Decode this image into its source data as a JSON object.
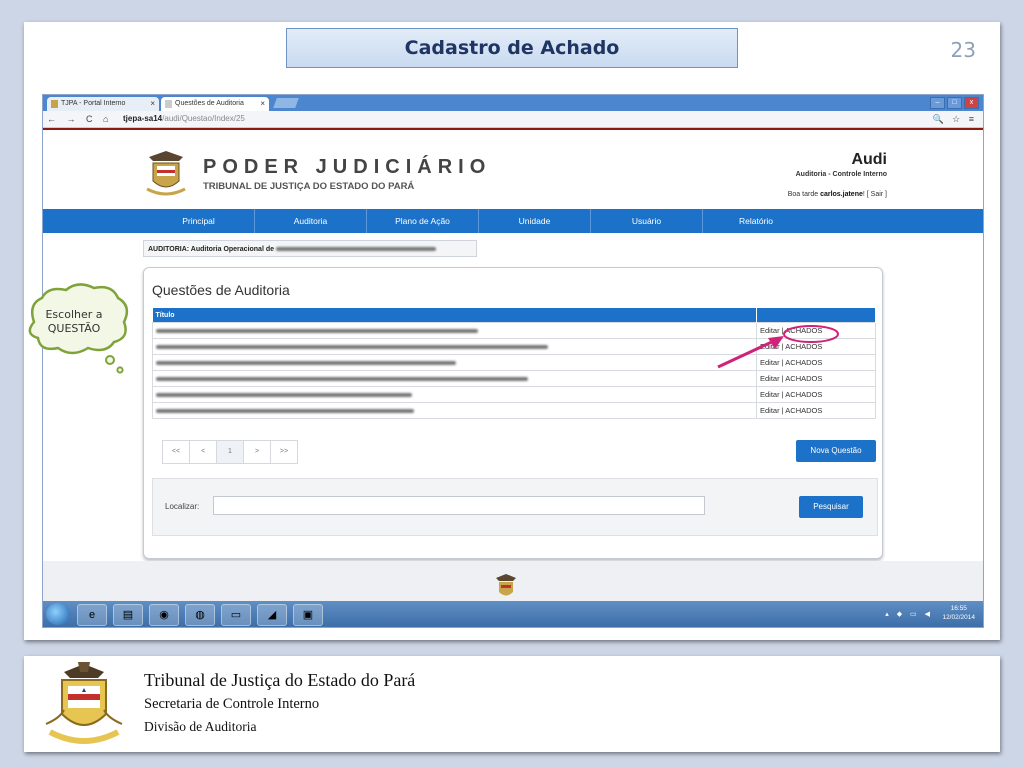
{
  "slide": {
    "title": "Cadastro de Achado",
    "number": "23"
  },
  "browser": {
    "tabs": [
      {
        "label": "TJPA - Portal Interno"
      },
      {
        "label": "Questões de Auditoria"
      }
    ],
    "url_host": "tjepa-sa14",
    "url_path": "/audi/Questao/Index/25",
    "close_glyph": "×",
    "nav_glyphs": "← → C ⌂",
    "tool_glyphs": "🔍 ☆ ≡"
  },
  "header": {
    "org_title": "PODER JUDICIÁRIO",
    "org_subtitle": "TRIBUNAL DE JUSTIÇA DO ESTADO DO PARÁ",
    "app_name": "Audi",
    "app_subtitle": "Auditoria - Controle Interno",
    "greeting_prefix": "Boa tarde ",
    "user_name": "carlos.jatene",
    "greeting_suffix": "! [ Sair ]"
  },
  "menu": {
    "items": [
      {
        "label": "Principal"
      },
      {
        "label": "Auditoria"
      },
      {
        "label": "Plano de Ação"
      },
      {
        "label": "Unidade"
      },
      {
        "label": "Usuário"
      },
      {
        "label": "Relatório"
      }
    ]
  },
  "breadcrumb": {
    "label": "AUDITORIA: Auditoria Operacional de"
  },
  "panel": {
    "title": "Questões de Auditoria",
    "column_title": "Título",
    "rows": [
      {
        "action": "Editar | ACHADOS",
        "blur_width": 322
      },
      {
        "action": "Editar | ACHADOS",
        "blur_width": 392
      },
      {
        "action": "Editar | ACHADOS",
        "blur_width": 300
      },
      {
        "action": "Editar | ACHADOS",
        "blur_width": 372
      },
      {
        "action": "Editar | ACHADOS",
        "blur_width": 256
      },
      {
        "action": "Editar | ACHADOS",
        "blur_width": 258
      }
    ],
    "pager": [
      "<<",
      "<",
      "1",
      ">",
      ">>"
    ],
    "new_button": "Nova Questão",
    "search_label": "Localizar:",
    "search_value": "",
    "search_button": "Pesquisar"
  },
  "taskbar": {
    "time": "16:55",
    "date": "12/02/2014"
  },
  "callout": {
    "text_line1": "Escolher a",
    "text_line2": "QUESTÃO"
  },
  "footer": {
    "line1": "Tribunal de Justiça do Estado do  Pará",
    "line2": "Secretaria de Controle Interno",
    "line3": "Divisão de Auditoria"
  },
  "colors": {
    "accent": "#1b72c8",
    "highlight": "#d0227a"
  }
}
